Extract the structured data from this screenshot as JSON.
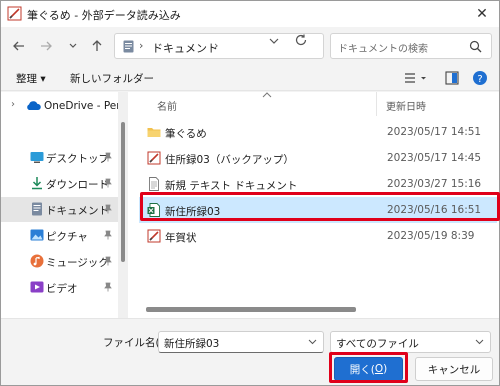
{
  "window": {
    "title": "筆ぐるめ - 外部データ読み込み",
    "close_glyph": "✕"
  },
  "address": {
    "crumb_sep": "›",
    "location": "ドキュメント",
    "search_placeholder": "ドキュメントの検索"
  },
  "toolbar": {
    "organize": "整理 ▾",
    "new_folder": "新しいフォルダー"
  },
  "nav_pane": {
    "onedrive": "OneDrive - Perso",
    "items": [
      {
        "label": "デスクトップ",
        "icon": "desktop-icon",
        "pinned": true
      },
      {
        "label": "ダウンロード",
        "icon": "download-icon",
        "pinned": true
      },
      {
        "label": "ドキュメント",
        "icon": "document-icon",
        "pinned": true,
        "selected": true
      },
      {
        "label": "ピクチャ",
        "icon": "picture-icon",
        "pinned": true
      },
      {
        "label": "ミュージック",
        "icon": "music-icon",
        "pinned": true
      },
      {
        "label": "ビデオ",
        "icon": "video-icon",
        "pinned": true
      }
    ]
  },
  "file_list": {
    "col_name": "名前",
    "col_date": "更新日時",
    "rows": [
      {
        "name": "筆ぐるめ",
        "date": "2023/05/17 14:51",
        "icon": "folder-icon"
      },
      {
        "name": "住所録03（バックアップ）",
        "date": "2023/05/17 14:45",
        "icon": "fudegurume-file-icon"
      },
      {
        "name": "新規 テキスト ドキュメント",
        "date": "2023/03/27 15:16",
        "icon": "text-file-icon"
      },
      {
        "name": "新住所録03",
        "date": "2023/05/16 16:51",
        "icon": "excel-file-icon",
        "selected": true
      },
      {
        "name": "年賀状",
        "date": "2023/05/19 8:39",
        "icon": "fudegurume-file-icon"
      }
    ]
  },
  "bottom": {
    "filename_label_pre": "ファイル名(",
    "filename_label_key": "N",
    "filename_label_post": "):",
    "filename_value": "新住所録03",
    "filetype_value": "すべてのファイル",
    "open_pre": "開く(",
    "open_key": "O",
    "open_post": ")",
    "cancel": "キャンセル"
  },
  "colors": {
    "selection": "#cce8ff",
    "highlight_frame": "#e0001a",
    "primary_button": "#1f6fd1",
    "folder": "#f2c14e",
    "excel": "#1d7044"
  }
}
